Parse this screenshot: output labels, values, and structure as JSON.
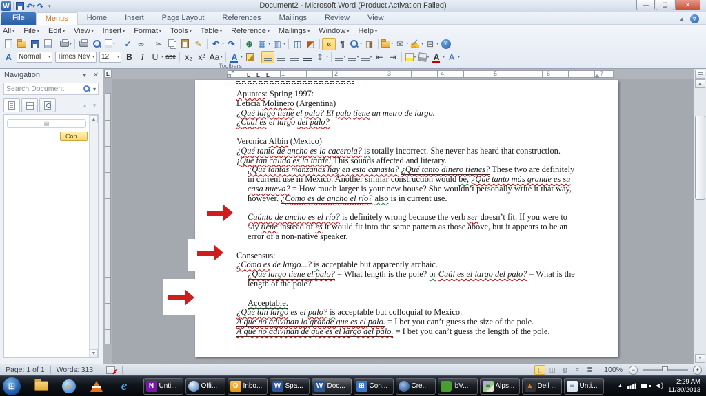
{
  "window": {
    "title": "Document2  -  Microsoft Word (Product Activation Failed)"
  },
  "ribbon": {
    "tabs": [
      {
        "label": "File",
        "type": "file"
      },
      {
        "label": "Menus",
        "active": true
      },
      {
        "label": "Home"
      },
      {
        "label": "Insert"
      },
      {
        "label": "Page Layout"
      },
      {
        "label": "References"
      },
      {
        "label": "Mailings"
      },
      {
        "label": "Review"
      },
      {
        "label": "View"
      }
    ],
    "group_label": "Toolbars"
  },
  "menubar": [
    "All",
    "File",
    "Edit",
    "View",
    "Insert",
    "Format",
    "Tools",
    "Table",
    "Reference",
    "Mailings",
    "Window",
    "Help"
  ],
  "toolbar_main": [
    {
      "name": "new-document",
      "cls": "ic-doc"
    },
    {
      "name": "open",
      "cls": "ic-folder"
    },
    {
      "name": "save",
      "cls": "ic-save"
    },
    {
      "name": "permission-document",
      "cls": "ic-doc2"
    },
    {
      "sep": 1
    },
    {
      "name": "print-quick",
      "cls": "ic-printer",
      "caret": 1
    },
    {
      "sep": 1
    },
    {
      "name": "print",
      "cls": "ic-printer2"
    },
    {
      "name": "print-preview",
      "cls": "ic-mag"
    },
    {
      "name": "page-setup",
      "cls": "ic-doc3",
      "caret": 1
    },
    {
      "sep": 1
    },
    {
      "name": "spelling-grammar",
      "glyph": "✓",
      "color": "#2a62b5",
      "bold": 1
    },
    {
      "name": "find",
      "glyph": "∞",
      "color": "#3c4656",
      "bold": 1
    },
    {
      "sep": 1
    },
    {
      "name": "cut",
      "glyph": "✂",
      "color": "#5a6472"
    },
    {
      "name": "copy",
      "cls": "ic-copy"
    },
    {
      "name": "paste",
      "cls": "ic-paste"
    },
    {
      "name": "format-painter",
      "glyph": "✎",
      "color": "#c09227"
    },
    {
      "sep": 1
    },
    {
      "name": "undo",
      "glyph": "↶",
      "color": "#2a62b5",
      "bold": 1,
      "caret": 1
    },
    {
      "name": "redo",
      "glyph": "↷",
      "color": "#2a62b5",
      "bold": 1
    },
    {
      "sep": 1
    },
    {
      "name": "insert-hyperlink",
      "glyph": "⊕",
      "color": "#2f7d4f",
      "bold": 1
    },
    {
      "name": "insert-table",
      "glyph": "▦",
      "color": "#4a7ab5",
      "caret": 1
    },
    {
      "name": "columns",
      "glyph": "▥",
      "color": "#4a7ab5",
      "caret": 1
    },
    {
      "sep": 1
    },
    {
      "name": "two-pages-view",
      "glyph": "◫",
      "color": "#2a62b5"
    },
    {
      "name": "switch-windows",
      "glyph": "◩",
      "color": "#b5541e"
    },
    {
      "sep": 1
    },
    {
      "name": "toggle-classic-menus",
      "glyph": "«",
      "color": "#6b520f",
      "bold": 1,
      "hl": 1
    },
    {
      "name": "formatting-marks",
      "glyph": "¶",
      "color": "#3c4656",
      "bold": 1
    },
    {
      "name": "zoom-tool",
      "cls": "ic-mag",
      "caret": 1
    },
    {
      "name": "dictionary",
      "glyph": "◨",
      "color": "#8a6d3b"
    },
    {
      "sep": 1
    },
    {
      "name": "folder-tools",
      "cls": "ic-folder",
      "caret": 1
    },
    {
      "name": "send-mail",
      "glyph": "✉",
      "color": "#5a6472",
      "caret": 1
    },
    {
      "name": "signature-line",
      "glyph": "✍",
      "color": "#c09227",
      "caret": 1
    },
    {
      "name": "object-box",
      "glyph": "⊟",
      "color": "#5a6472",
      "caret": 1
    },
    {
      "name": "help",
      "cls": "ic-help",
      "glyph": "?"
    }
  ],
  "toolbar_format": [
    {
      "name": "styles-gallery",
      "glyph": "A",
      "color": "#2a62b5",
      "bold": 1
    },
    {
      "type": "select",
      "name": "style-select",
      "value": "Normal",
      "w": 52
    },
    {
      "type": "select",
      "name": "font-select",
      "value": "Times Nev",
      "w": 60
    },
    {
      "type": "select",
      "name": "size-select",
      "value": "12",
      "w": 32
    },
    {
      "name": "bold",
      "glyph": "B",
      "color": "#333",
      "bold": 1
    },
    {
      "name": "italic",
      "glyph": "I",
      "color": "#333",
      "italic": 1
    },
    {
      "name": "underline",
      "glyph": "U",
      "color": "#333",
      "underl": 1,
      "caret": 1
    },
    {
      "name": "strikethrough",
      "glyph": "abc",
      "color": "#333",
      "strike": 1
    },
    {
      "sep": 1
    },
    {
      "name": "subscript",
      "glyph": "x₂",
      "color": "#333"
    },
    {
      "name": "superscript",
      "glyph": "x²",
      "color": "#333"
    },
    {
      "name": "change-case",
      "glyph": "Aa",
      "color": "#333",
      "caret": 1
    },
    {
      "sep": 1
    },
    {
      "name": "font-color-pen",
      "glyph": "A",
      "color": "#2a62b5",
      "bold": 1,
      "bar": "#2a62b5",
      "caret": 1
    },
    {
      "name": "highlight-pen",
      "cls": "ic-pen"
    },
    {
      "sep": 1
    },
    {
      "name": "align-left",
      "cls": "ic-lines",
      "hl": 1
    },
    {
      "name": "align-center",
      "cls": "ic-lines"
    },
    {
      "name": "align-right",
      "cls": "ic-lines"
    },
    {
      "name": "justify",
      "cls": "ic-lines-dark"
    },
    {
      "name": "line-spacing",
      "glyph": "⇕",
      "color": "#3c4656",
      "caret": 1
    },
    {
      "sep": 1
    },
    {
      "name": "numbering",
      "cls": "ic-lines",
      "caret": 1
    },
    {
      "name": "bullets",
      "cls": "ic-lines",
      "caret": 1
    },
    {
      "name": "multilevel-list",
      "cls": "ic-lines",
      "caret": 1
    },
    {
      "name": "decrease-indent",
      "glyph": "⇤",
      "color": "#3c4656"
    },
    {
      "name": "increase-indent",
      "glyph": "⇥",
      "color": "#3c4656"
    },
    {
      "sep": 1
    },
    {
      "name": "text-highlight-color",
      "cls": "ic-hl",
      "caret": 1
    },
    {
      "name": "shading",
      "cls": "ic-bucket",
      "caret": 1
    },
    {
      "name": "font-color",
      "glyph": "A",
      "color": "#333",
      "bold": 1,
      "bar": "#c00000",
      "caret": 1
    },
    {
      "name": "character-border",
      "glyph": "A",
      "color": "#2a62b5",
      "caret": 1
    }
  ],
  "navigation": {
    "title": "Navigation",
    "search_placeholder": "Search Document",
    "tooltip_label": "Con...",
    "tabs": [
      "browse-headings",
      "browse-pages",
      "browse-results"
    ]
  },
  "ruler": {
    "numbers": [
      "1",
      "2",
      "3",
      "4",
      "5",
      "6",
      "7"
    ],
    "tab_stops": [
      195,
      209,
      223
    ]
  },
  "document": {
    "partial_top_line": true,
    "lines": [
      {
        "type": "text",
        "ind": 0,
        "seg": [
          [
            "Apuntes",
            "w"
          ],
          [
            ": Spring 1997:",
            ""
          ]
        ]
      },
      {
        "type": "text",
        "ind": 0,
        "seg": [
          [
            "Leticia ",
            ""
          ],
          [
            "Molinero",
            "w"
          ],
          [
            " (Argentina)",
            ""
          ]
        ]
      },
      {
        "type": "text",
        "ind": 0,
        "seg": [
          [
            "¿Qué largo tiene",
            "iw"
          ],
          [
            " el ",
            "i"
          ],
          [
            "palo",
            "iw"
          ],
          [
            "? El ",
            "i"
          ],
          [
            "palo",
            "iw"
          ],
          [
            " ",
            "i"
          ],
          [
            "tiene",
            "iw"
          ],
          [
            " un metro de largo.",
            "i"
          ]
        ]
      },
      {
        "type": "text",
        "ind": 0,
        "seg": [
          [
            "¿Cuál es",
            "iw"
          ],
          [
            " el largo ",
            "i"
          ],
          [
            "del palo?",
            "iw"
          ]
        ]
      },
      {
        "type": "blank"
      },
      {
        "type": "text",
        "ind": 0,
        "seg": [
          [
            "Veronica ",
            ""
          ],
          [
            "Albín",
            "w"
          ],
          [
            " (Mexico)",
            ""
          ]
        ]
      },
      {
        "type": "text",
        "ind": 0,
        "seg": [
          [
            "¿Qué tanto de ancho es la cacerola?",
            "iw"
          ],
          [
            " ",
            ""
          ],
          [
            "is",
            "g"
          ],
          [
            " totally incorrect. She never has heard that construction.",
            ""
          ]
        ]
      },
      {
        "type": "text",
        "ind": 0,
        "seg": [
          [
            "¡Qué tan cálida es la tarde!",
            "iw"
          ],
          [
            " This sounds affected and literary.",
            ""
          ]
        ]
      },
      {
        "type": "text",
        "ind": 1,
        "seg": [
          [
            "¿Qué tantas manzanas hay en esta canasta?",
            "iw"
          ],
          [
            " ",
            "i"
          ],
          [
            "¿Qué tanto dinero tienes?",
            "iuw"
          ],
          [
            " These two are definitely",
            ""
          ]
        ]
      },
      {
        "type": "text",
        "ind": 1,
        "seg": [
          [
            "in current use in Mexico. Another similar construction would ",
            ""
          ],
          [
            "be,",
            "g"
          ],
          [
            " ",
            ""
          ],
          [
            "¿Qué tanto más grande es su",
            "iw"
          ]
        ]
      },
      {
        "type": "text",
        "ind": 1,
        "seg": [
          [
            "casa nueva?",
            "iw"
          ],
          [
            " ",
            "i"
          ],
          [
            "= How",
            "u"
          ],
          [
            " much larger is your new house? She wouldn’t personally write it that way,",
            ""
          ]
        ]
      },
      {
        "type": "text",
        "ind": 1,
        "seg": [
          [
            "however. ",
            ""
          ],
          [
            "¿Cómo es de ancho el río?",
            "iuw"
          ],
          [
            " ",
            ""
          ],
          [
            "also",
            "g"
          ],
          [
            " is in current use.",
            ""
          ]
        ]
      },
      {
        "type": "cursor",
        "ind": 1
      },
      {
        "type": "text",
        "ind": 1,
        "seg": [
          [
            "Cuánto de ancho es el río?",
            "iuw"
          ],
          [
            " is definitely wrong because the verb ",
            ""
          ],
          [
            "ser",
            "iw"
          ],
          [
            " doesn’t fit. If you were to",
            ""
          ]
        ]
      },
      {
        "type": "text",
        "ind": 1,
        "seg": [
          [
            "say ",
            ""
          ],
          [
            "tiene",
            "iw"
          ],
          [
            " instead of ",
            ""
          ],
          [
            "es",
            "iw"
          ],
          [
            " it would fit into the same pattern as those above, but it appears to be an",
            ""
          ]
        ]
      },
      {
        "type": "text",
        "ind": 1,
        "seg": [
          [
            "error of a non-native speaker.",
            ""
          ]
        ]
      },
      {
        "type": "cursor",
        "ind": 1
      },
      {
        "type": "text",
        "ind": 0,
        "seg": [
          [
            "Consensus:",
            ""
          ]
        ]
      },
      {
        "type": "text",
        "ind": 0,
        "seg": [
          [
            "¿Cómo es",
            "iw"
          ],
          [
            " de largo...? ",
            "i"
          ],
          [
            "is",
            "g"
          ],
          [
            " acceptable but apparently archaic.",
            ""
          ]
        ]
      },
      {
        "type": "text",
        "ind": 1,
        "seg": [
          [
            "¿Qué largo tiene el palo?",
            "iuw"
          ],
          [
            " = What length is the pole? ",
            ""
          ],
          [
            "or",
            "g"
          ],
          [
            " ",
            ""
          ],
          [
            "Cuál es el largo del palo?",
            "iw"
          ],
          [
            " = What is the",
            ""
          ]
        ]
      },
      {
        "type": "text",
        "ind": 1,
        "seg": [
          [
            "length of the pole?",
            ""
          ]
        ]
      },
      {
        "type": "cursor",
        "ind": 1
      },
      {
        "type": "text",
        "ind": 1,
        "seg": [
          [
            "Acceptable.",
            "ug"
          ]
        ]
      },
      {
        "type": "text",
        "ind": 0,
        "seg": [
          [
            "¿Qué tan largo",
            "iw"
          ],
          [
            " es el ",
            "i"
          ],
          [
            "palo?",
            "iw"
          ],
          [
            " ",
            ""
          ],
          [
            "is",
            "g"
          ],
          [
            " acceptable but colloquial to Mexico.",
            ""
          ]
        ]
      },
      {
        "type": "text",
        "ind": 0,
        "seg": [
          [
            "A que no adivinan lo grande que es el palo.",
            "iuw"
          ],
          [
            " = I bet you can’t guess the size of the pole.",
            ""
          ]
        ]
      },
      {
        "type": "text",
        "ind": 0,
        "seg": [
          [
            "A que no adivinan de que es el largo del palo.",
            "iuw"
          ],
          [
            " = I bet you can’t guess the length of the pole.",
            ""
          ]
        ]
      }
    ]
  },
  "status_bar": {
    "page": "Page: 1 of 1",
    "words": "Words: 313",
    "zoom_level": "100%",
    "views": [
      "print-layout",
      "full-screen-reading",
      "web-layout",
      "outline",
      "draft"
    ]
  },
  "taskbar": {
    "quick_launch": [
      {
        "name": "windows-explorer",
        "cls": "tk-folder"
      },
      {
        "name": "media-player",
        "cls": "tk-wmp",
        "glyph": "▸"
      },
      {
        "name": "vlc-player",
        "cls": "tk-vlc"
      },
      {
        "name": "internet-explorer",
        "cls": "tk-ie",
        "glyph": "e"
      }
    ],
    "buttons": [
      {
        "label": "Unti...",
        "icon": "onenote",
        "glyph": "N"
      },
      {
        "label": "Offi...",
        "icon": "sphere",
        "glyph": ""
      },
      {
        "label": "Inbo...",
        "icon": "outlook",
        "glyph": "O"
      },
      {
        "label": "Spa...",
        "icon": "word",
        "glyph": "W"
      },
      {
        "label": "Doc...",
        "icon": "word",
        "glyph": "W",
        "active": 1
      },
      {
        "label": "Con...",
        "icon": "panel",
        "glyph": "⊞"
      },
      {
        "label": "Cre...",
        "icon": "ring",
        "glyph": ""
      },
      {
        "label": "ibV...",
        "icon": "green",
        "glyph": ""
      },
      {
        "label": "Alps...",
        "icon": "layers",
        "glyph": "≡"
      },
      {
        "label": "Dell ...",
        "icon": "dell",
        "glyph": "▲"
      },
      {
        "label": "Unti...",
        "icon": "notepad",
        "glyph": "≡"
      }
    ],
    "tray": {
      "time": "2:29 AM",
      "date": "11/30/2013"
    }
  }
}
